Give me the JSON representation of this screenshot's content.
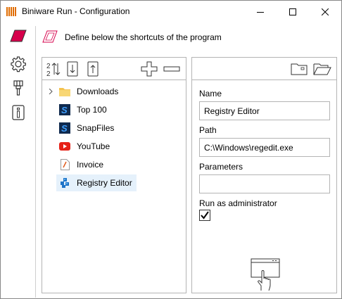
{
  "window": {
    "title": "Biniware Run - Configuration",
    "controls": {
      "minimize": "minimize",
      "maximize": "maximize",
      "close": "close"
    }
  },
  "nav": {
    "items": [
      {
        "name": "shortcuts",
        "icon": "shortcut-parallelogram-icon",
        "color": "#d6004b"
      },
      {
        "name": "settings",
        "icon": "gear-icon"
      },
      {
        "name": "cleanup",
        "icon": "brush-icon"
      },
      {
        "name": "about",
        "icon": "info-icon"
      }
    ]
  },
  "header": {
    "text": "Define below the shortcuts of the program"
  },
  "toolbar": {
    "buttons": [
      "sort-az-icon",
      "move-down-icon",
      "move-up-icon",
      "add-icon",
      "remove-icon"
    ],
    "right_buttons": [
      "folder-icon",
      "open-folder-icon"
    ]
  },
  "tree": {
    "items": [
      {
        "label": "Downloads",
        "icon": "folder-icon",
        "color": "#f4c24d",
        "expandable": true
      },
      {
        "label": "Top 100",
        "icon": "snapfiles-icon",
        "color": "#1560a8"
      },
      {
        "label": "SnapFiles",
        "icon": "snapfiles-icon",
        "color": "#1560a8"
      },
      {
        "label": "YouTube",
        "icon": "youtube-icon",
        "color": "#e62117"
      },
      {
        "label": "Invoice",
        "icon": "pdf-document-icon",
        "color": "#e05a1a"
      },
      {
        "label": "Registry Editor",
        "icon": "registry-editor-icon",
        "color": "#1f74c8",
        "selected": true
      }
    ]
  },
  "form": {
    "name_label": "Name",
    "name_value": "Registry Editor",
    "path_label": "Path",
    "path_value": "C:\\Windows\\regedit.exe",
    "parameters_label": "Parameters",
    "parameters_value": "",
    "admin_label": "Run as administrator",
    "admin_checked": true
  },
  "colors": {
    "accent": "#d6004b",
    "selection": "#e5f1fb",
    "border": "#b4b4b4"
  }
}
